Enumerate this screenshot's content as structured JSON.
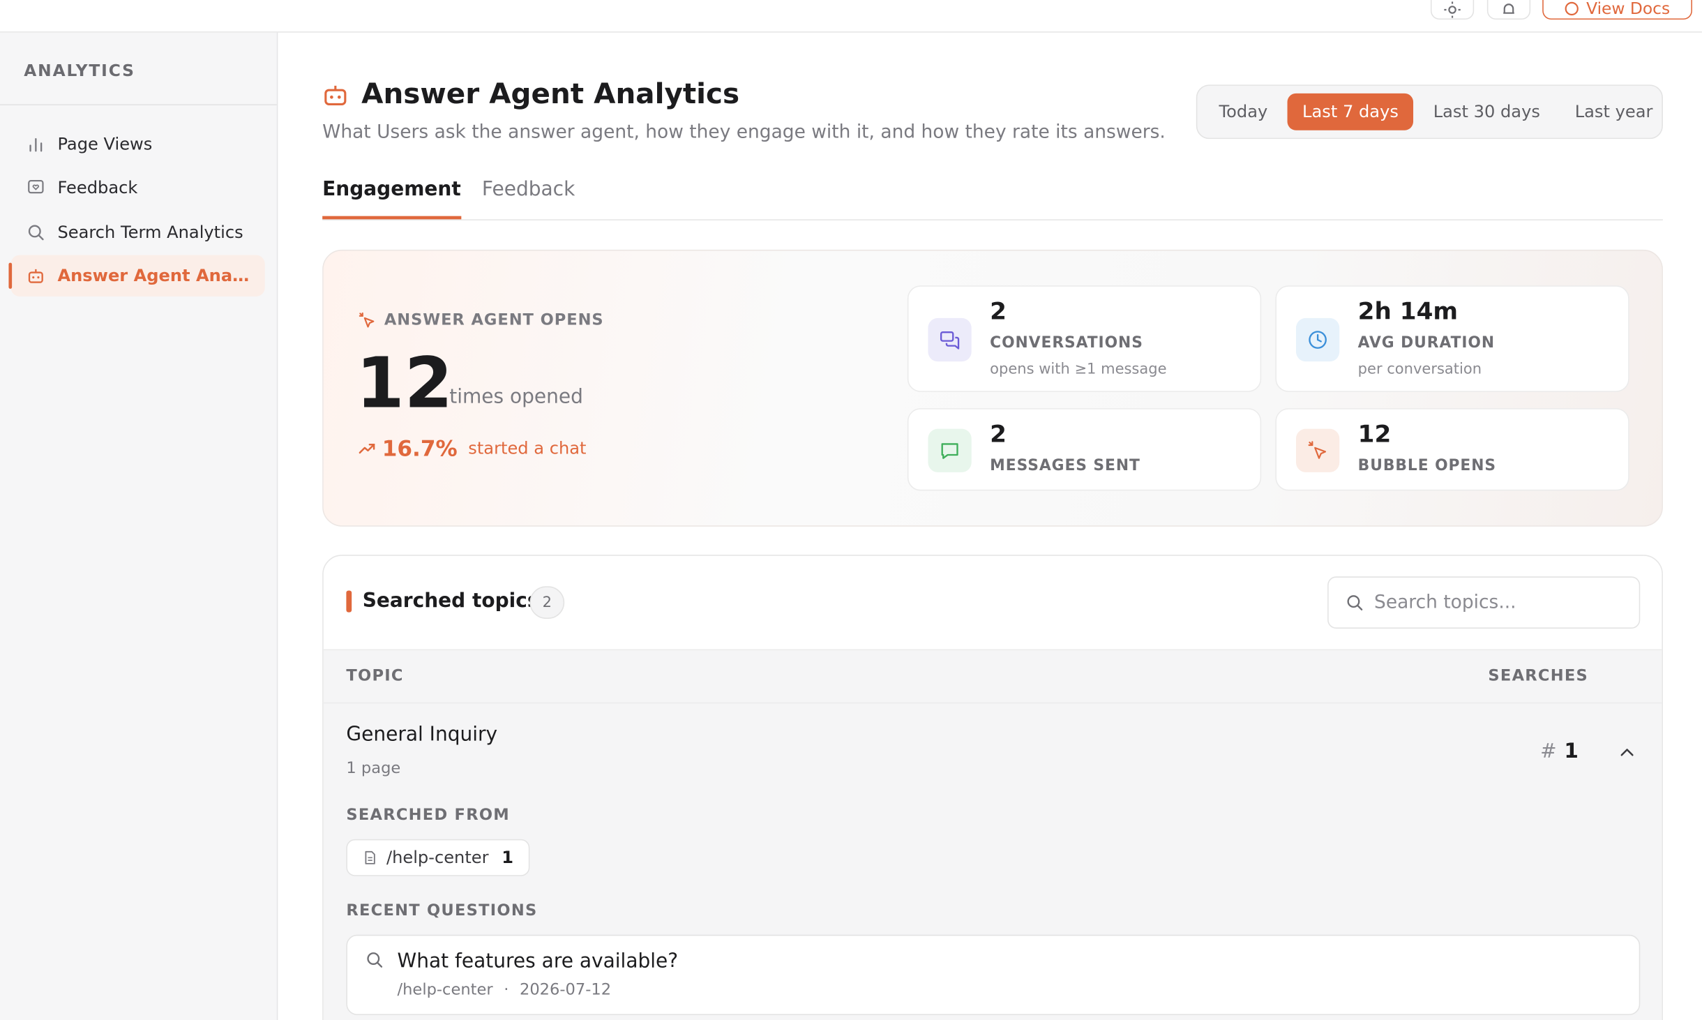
{
  "topbar": {
    "docs_label": "View Docs"
  },
  "sidebar": {
    "title": "ANALYTICS",
    "items": [
      {
        "label": "Page Views",
        "icon": "bar-chart-icon"
      },
      {
        "label": "Feedback",
        "icon": "feedback-icon"
      },
      {
        "label": "Search Term Analytics",
        "icon": "search-icon"
      },
      {
        "label": "Answer Agent Analytics",
        "icon": "bot-icon",
        "active": true
      }
    ]
  },
  "header": {
    "title": "Answer Agent Analytics",
    "subtitle": "What Users ask the answer agent, how they engage with it, and how they rate its answers.",
    "ranges": [
      "Today",
      "Last 7 days",
      "Last 30 days",
      "Last year"
    ],
    "selected_range": "Last 7 days"
  },
  "tabs": [
    "Engagement",
    "Feedback"
  ],
  "metrics": {
    "opens_label": "ANSWER AGENT OPENS",
    "opens_value": "12",
    "opens_unit": "times opened",
    "trend_pct": "16.7%",
    "trend_text": "started a chat",
    "stats": [
      {
        "value": "2",
        "label": "CONVERSATIONS",
        "sub": "opens with ≥1 message",
        "icon": "chat-bubbles-icon"
      },
      {
        "value": "2h 14m",
        "label": "AVG DURATION",
        "sub": "per conversation",
        "icon": "clock-icon"
      },
      {
        "value": "2",
        "label": "MESSAGES SENT",
        "sub": "",
        "icon": "message-icon"
      },
      {
        "value": "12",
        "label": "BUBBLE OPENS",
        "sub": "",
        "icon": "click-icon"
      }
    ]
  },
  "topics": {
    "title": "Searched topics",
    "count": "2",
    "search_placeholder": "Search topics...",
    "columns": {
      "topic": "TOPIC",
      "searches": "SEARCHES"
    },
    "rows": [
      {
        "name": "General Inquiry",
        "pages": "1 page",
        "hash": "#",
        "searches": "1",
        "searched_from_label": "SEARCHED FROM",
        "sources": [
          {
            "path": "/help-center",
            "count": "1"
          }
        ],
        "recent_label": "RECENT QUESTIONS",
        "questions": [
          {
            "text": "What features are available?",
            "path": "/help-center",
            "sep": "·",
            "date": "2026-07-12"
          }
        ]
      }
    ]
  },
  "colors": {
    "accent": "#e0683c",
    "purple": "#6b5bd6",
    "blue": "#3b8fd9",
    "green": "#3fae5a"
  }
}
